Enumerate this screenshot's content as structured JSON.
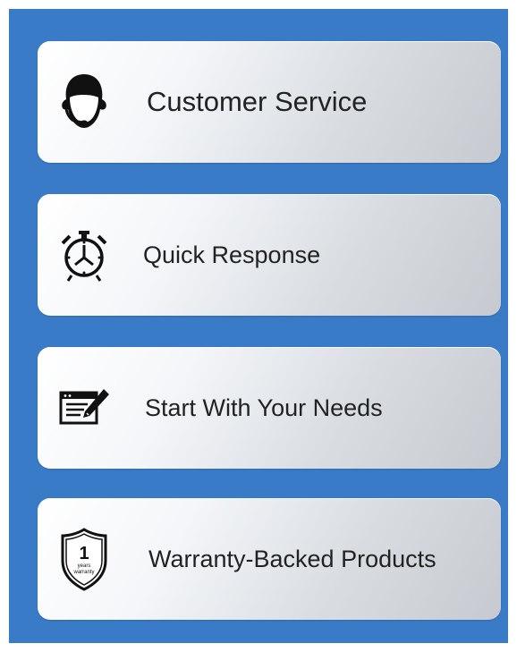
{
  "colors": {
    "panel_background": "#3a7bc8",
    "icon_color": "#111111",
    "label_color": "#222222"
  },
  "cards": [
    {
      "label": "Customer Service",
      "icon": "headset-agent-icon"
    },
    {
      "label": "Quick Response",
      "icon": "stopwatch-icon"
    },
    {
      "label": "Start With Your Needs",
      "icon": "form-edit-icon"
    },
    {
      "label": "Warranty-Backed Products",
      "icon": "warranty-shield-icon"
    }
  ],
  "warranty_badge": {
    "number": "1",
    "line1": "years",
    "line2": "warranty"
  }
}
